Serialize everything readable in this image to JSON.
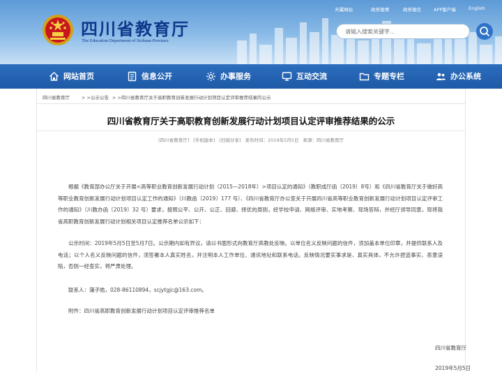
{
  "top_links": [
    "天翼网站",
    "政务微博",
    "政务微信",
    "APP客户端",
    "English"
  ],
  "logo": {
    "title": "四川省教育厅",
    "subtitle": "The Education Department of Sichuan Province"
  },
  "search": {
    "placeholder": "请输入搜索关键字..."
  },
  "nav": [
    {
      "label": "网站首页",
      "icon": "home-icon"
    },
    {
      "label": "信息公开",
      "icon": "document-icon"
    },
    {
      "label": "办事服务",
      "icon": "service-icon"
    },
    {
      "label": "互动交流",
      "icon": "monitor-icon"
    },
    {
      "label": "专题专栏",
      "icon": "folder-icon"
    },
    {
      "label": "办公系统",
      "icon": "office-icon"
    }
  ],
  "breadcrumb": [
    "四川省教育厅",
    "> >公示公告",
    "> >四川省教育厅关于高职教育创新发展行动计划项目认定评审推荐结果的公示"
  ],
  "article": {
    "title": "四川省教育厅关于高职教育创新发展行动计划项目认定评审推荐结果的公示",
    "meta": [
      "[四川省教育厅]",
      "[手机版本]",
      "[扫描分享]",
      "发布时间：2019年5月5日",
      "来源：四川省教育厅"
    ],
    "paragraphs": [
      "根据《教育部办公厅关于开展<高等职业教育创新发展行动计划（2015—2018年）>项目认定的通知》（教职成厅函〔2019〕8号）和《四川省教育厅关于做好高等职业教育创新发展行动计划项目认定工作的通知》（川教函〔2019〕177 号）、《四川省教育厅办公室关于开展四川省高等职业教育创新发展行动计划项目认定评审工作的通知》（川教办函〔2019〕32 号）要求，按照公平、公开、公正、回避、择优的原则，经学校申请、网络评审、实地考察、现场答辩，并经厅领导同意，现将我省高职教育创新发展行动计划相关项目认定推荐名单公示如下：",
      "公示时间：2019年5月5日至5月7日。公示期内如有异议，请以书面形式向教育厅高教处反映。以单位名义反映问题的信件，须加盖本单位印章，并提供联系人及电话；以个人名义反映问题的信件，须签署本人真实姓名，并注明本人工作单位、通讯地址和联系电话。反映情况要实事求是、真实具体，不允许捏造事实、恶意误陷，否则一经查实，将严肃处理。"
    ],
    "contact": "联系人：蒲子皓，028-86110894，scjytgjc@163.com。",
    "attachment": "附件：四川省高职教育创新发展行动计划项目认定评审推荐名单",
    "signature": "四川省教育厅",
    "date": "2019年5月5日"
  },
  "colors": {
    "nav": "#1d59a6",
    "logo_text": "#10378a",
    "header_sky": "#8cbce8"
  }
}
